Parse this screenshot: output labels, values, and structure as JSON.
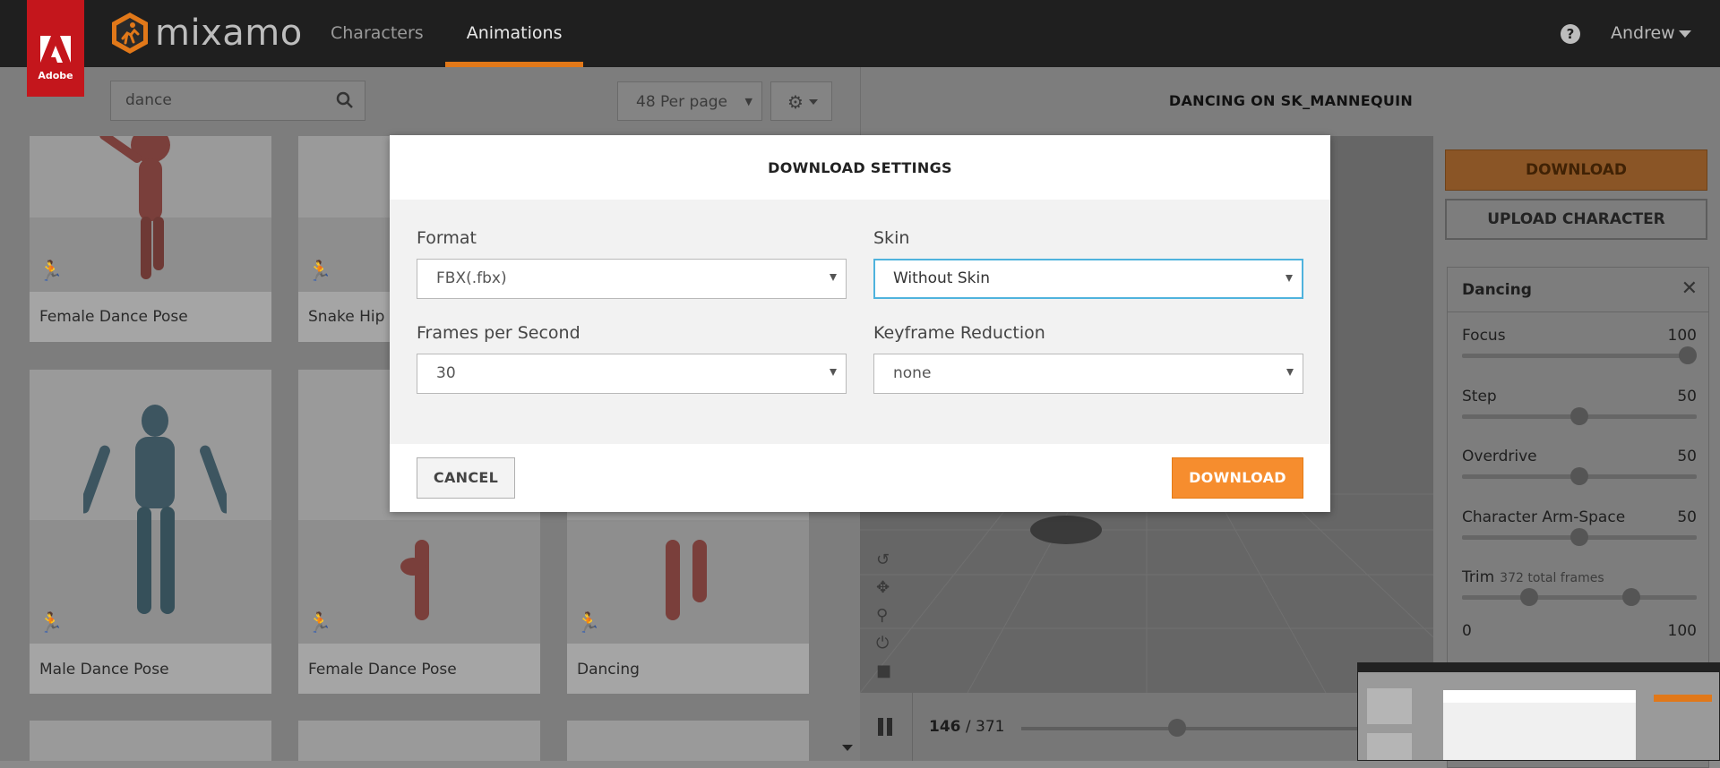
{
  "brand": {
    "adobe_text": "Adobe",
    "logo_text": "mixamo"
  },
  "nav": {
    "tabs": [
      {
        "label": "Characters"
      },
      {
        "label": "Animations"
      }
    ]
  },
  "header": {
    "help": "?",
    "user": "Andrew"
  },
  "search": {
    "value": "dance",
    "per_page": "48 Per page"
  },
  "grid": {
    "cards": [
      {
        "label": "Female Dance Pose"
      },
      {
        "label": "Snake Hip H"
      },
      {
        "label": "Male Dance Pose"
      },
      {
        "label": "Female Dance Pose"
      },
      {
        "label": "Dancing"
      }
    ]
  },
  "viewer": {
    "title": "DANCING ON SK_MANNEQUIN",
    "current_frame": "146",
    "total_frames": "/ 371",
    "playhead_fraction": 0.39
  },
  "panel": {
    "download_label": "DOWNLOAD",
    "upload_label": "UPLOAD CHARACTER",
    "animation_name": "Dancing",
    "close": "✕",
    "params": [
      {
        "name": "Focus",
        "value": "100",
        "level": 1.0
      },
      {
        "name": "Step",
        "value": "50",
        "level": 0.5
      },
      {
        "name": "Overdrive",
        "value": "50",
        "level": 0.5
      },
      {
        "name": "Character Arm-Space",
        "value": "50",
        "level": 0.5
      }
    ],
    "trim": {
      "name": "Trim",
      "note": "372 total frames",
      "min": "0",
      "max": "100",
      "start": 0.27,
      "end": 0.74
    }
  },
  "modal": {
    "title": "DOWNLOAD SETTINGS",
    "format": {
      "label": "Format",
      "value": "FBX(.fbx)"
    },
    "skin": {
      "label": "Skin",
      "value": "Without Skin"
    },
    "fps": {
      "label": "Frames per Second",
      "value": "30"
    },
    "keyframe": {
      "label": "Keyframe Reduction",
      "value": "none"
    },
    "cancel_label": "CANCEL",
    "download_label": "DOWNLOAD"
  },
  "colors": {
    "accent": "#f68d2e",
    "focus": "#4fb3dd",
    "adobe_red": "#c4161c",
    "topbar": "#1f1f1f"
  }
}
